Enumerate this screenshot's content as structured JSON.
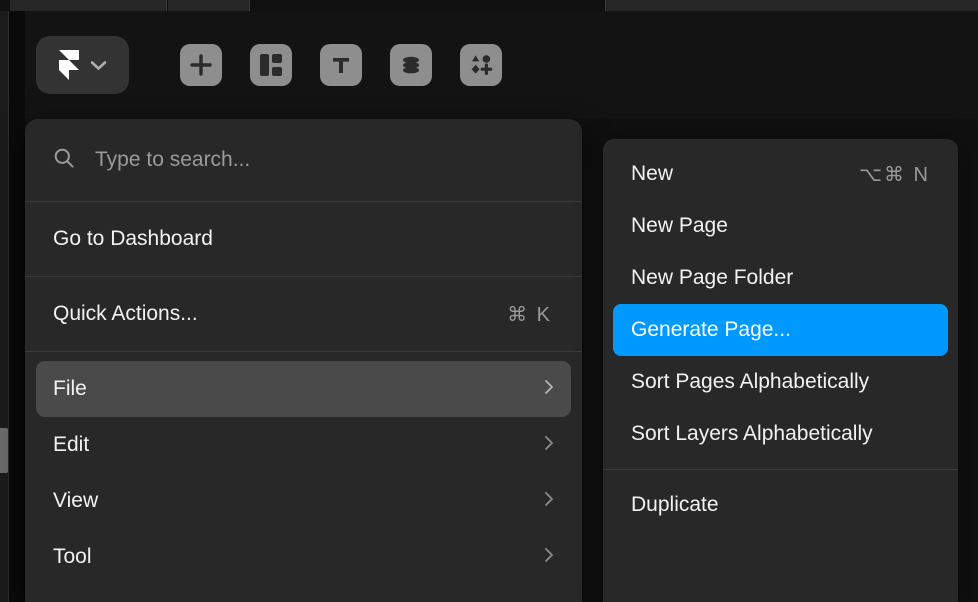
{
  "app": {
    "background_color": "#101010",
    "panel_color": "#282828",
    "accent_color": "#0099ff",
    "hover_color": "#4a4a4a"
  },
  "toolbar": {
    "brand": {
      "name": "framer-logo",
      "chevron": "chevron-down-icon"
    },
    "tools": [
      {
        "name": "insert-icon",
        "title": "Insert"
      },
      {
        "name": "layout-icon",
        "title": "Layout"
      },
      {
        "name": "text-icon",
        "title": "Text"
      },
      {
        "name": "cms-icon",
        "title": "CMS"
      },
      {
        "name": "assets-icon",
        "title": "Assets"
      }
    ]
  },
  "search": {
    "placeholder": "Type to search...",
    "value": "",
    "icon": "search-icon"
  },
  "main_menu": {
    "sections": [
      {
        "items": [
          {
            "label": "Go to Dashboard",
            "shortcut": "",
            "submenu": false,
            "active": false
          }
        ]
      },
      {
        "items": [
          {
            "label": "Quick Actions...",
            "shortcut": "⌘ K",
            "submenu": false,
            "active": false
          }
        ]
      },
      {
        "items": [
          {
            "label": "File",
            "shortcut": "",
            "submenu": true,
            "active": true
          },
          {
            "label": "Edit",
            "shortcut": "",
            "submenu": true,
            "active": false
          },
          {
            "label": "View",
            "shortcut": "",
            "submenu": true,
            "active": false
          },
          {
            "label": "Tool",
            "shortcut": "",
            "submenu": true,
            "active": false
          }
        ]
      }
    ]
  },
  "sub_menu": {
    "parent": "File",
    "sections": [
      {
        "items": [
          {
            "label": "New",
            "shortcut": "⌥⌘ N",
            "highlighted": false
          },
          {
            "label": "New Page",
            "shortcut": "",
            "highlighted": false
          },
          {
            "label": "New Page Folder",
            "shortcut": "",
            "highlighted": false
          },
          {
            "label": "Generate Page...",
            "shortcut": "",
            "highlighted": true
          },
          {
            "label": "Sort Pages Alphabetically",
            "shortcut": "",
            "highlighted": false
          },
          {
            "label": "Sort Layers Alphabetically",
            "shortcut": "",
            "highlighted": false
          }
        ]
      },
      {
        "items": [
          {
            "label": "Duplicate",
            "shortcut": "",
            "highlighted": false
          }
        ]
      }
    ]
  }
}
